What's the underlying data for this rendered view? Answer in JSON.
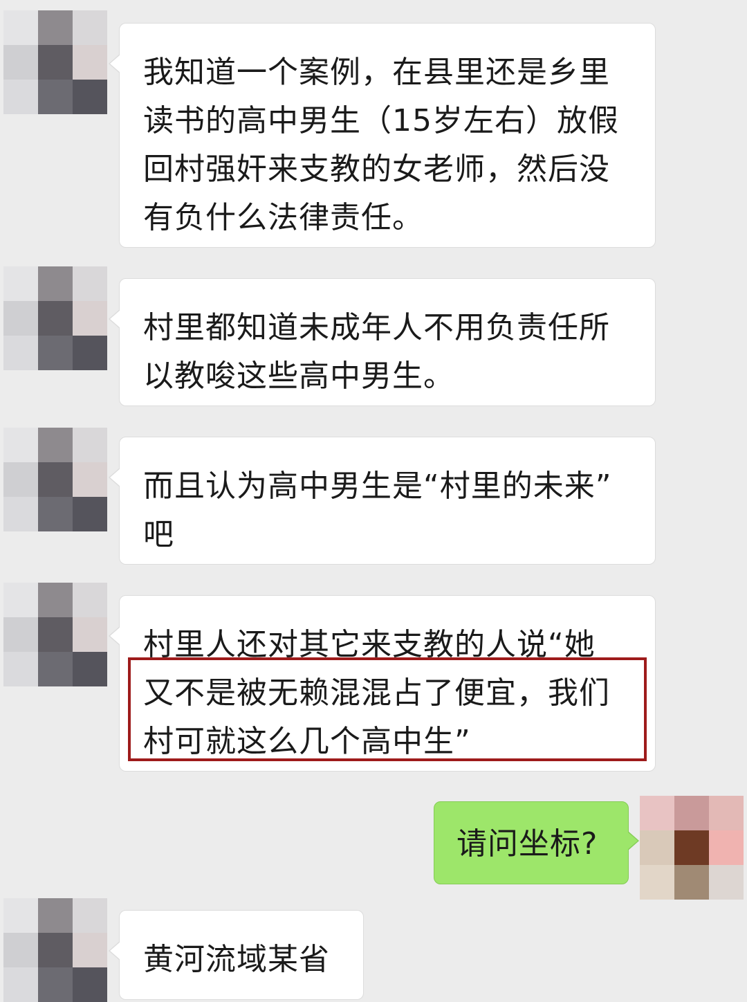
{
  "colors": {
    "background": "#ececec",
    "incoming_bubble": "#ffffff",
    "outgoing_bubble": "#9de66a",
    "highlight_border": "#9e1b1b"
  },
  "messages": [
    {
      "side": "left",
      "lines": [
        "我知道一个案例，在县里还是乡里",
        "读书的高中男生（15岁左右）放假",
        "回村强奸来支教的女老师，然后没",
        "有负什么法律责任。"
      ]
    },
    {
      "side": "left",
      "lines": [
        "村里都知道未成年人不用负责任所",
        "以教唆这些高中男生。"
      ]
    },
    {
      "side": "left",
      "lines": [
        "而且认为高中男生是“村里的未来”",
        "吧"
      ]
    },
    {
      "side": "left",
      "lines": [
        "村里人还对其它来支教的人说“她",
        "又不是被无赖混混占了便宜，我们",
        "村可就这么几个高中生”"
      ]
    },
    {
      "side": "right",
      "lines": [
        "请问坐标?"
      ]
    },
    {
      "side": "left",
      "lines": [
        "黄河流域某省"
      ]
    }
  ]
}
